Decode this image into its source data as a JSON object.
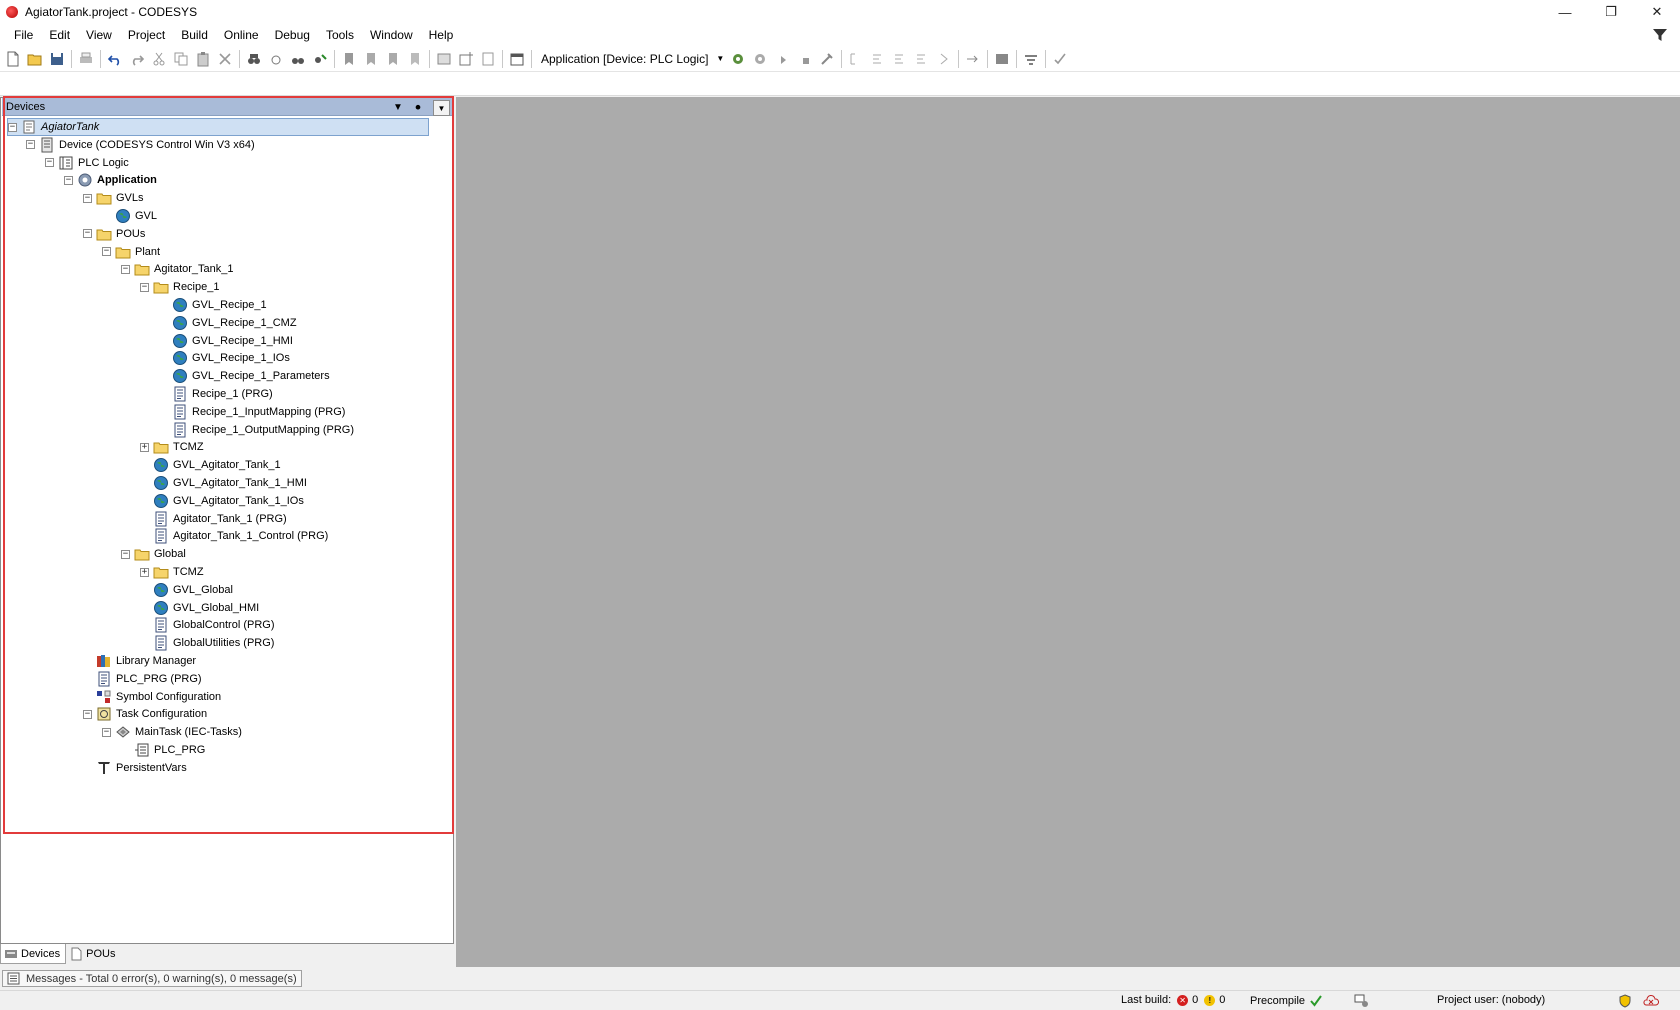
{
  "window": {
    "title": "AgiatorTank.project - CODESYS"
  },
  "menu": [
    "File",
    "Edit",
    "View",
    "Project",
    "Build",
    "Online",
    "Debug",
    "Tools",
    "Window",
    "Help"
  ],
  "toolbar": {
    "active_application": "Application [Device: PLC Logic]"
  },
  "devices_pane": {
    "title": "Devices",
    "tree": [
      {
        "label": "AgiatorTank",
        "icon": "project-icon",
        "level": 0,
        "exp": "-"
      },
      {
        "label": "Device (CODESYS Control Win V3 x64)",
        "icon": "device-icon",
        "level": 1,
        "exp": "-"
      },
      {
        "label": "PLC Logic",
        "icon": "plc-logic-icon",
        "level": 2,
        "exp": "-"
      },
      {
        "label": "Application",
        "icon": "application-gear-icon",
        "level": 3,
        "exp": "-",
        "bold": true
      },
      {
        "label": "GVLs",
        "icon": "folder-icon",
        "level": 4,
        "exp": "-"
      },
      {
        "label": "GVL",
        "icon": "gvl-globe-icon",
        "level": 5
      },
      {
        "label": "POUs",
        "icon": "folder-icon",
        "level": 4,
        "exp": "-"
      },
      {
        "label": "Plant",
        "icon": "folder-icon",
        "level": 5,
        "exp": "-"
      },
      {
        "label": "Agitator_Tank_1",
        "icon": "folder-icon",
        "level": 6,
        "exp": "-"
      },
      {
        "label": "Recipe_1",
        "icon": "folder-icon",
        "level": 7,
        "exp": "-"
      },
      {
        "label": "GVL_Recipe_1",
        "icon": "gvl-globe-icon",
        "level": 8
      },
      {
        "label": "GVL_Recipe_1_CMZ",
        "icon": "gvl-globe-icon",
        "level": 8
      },
      {
        "label": "GVL_Recipe_1_HMI",
        "icon": "gvl-globe-icon",
        "level": 8
      },
      {
        "label": "GVL_Recipe_1_IOs",
        "icon": "gvl-globe-icon",
        "level": 8
      },
      {
        "label": "GVL_Recipe_1_Parameters",
        "icon": "gvl-globe-icon",
        "level": 8
      },
      {
        "label": "Recipe_1 (PRG)",
        "icon": "prg-document-icon",
        "level": 8
      },
      {
        "label": "Recipe_1_InputMapping (PRG)",
        "icon": "prg-document-icon",
        "level": 8
      },
      {
        "label": "Recipe_1_OutputMapping (PRG)",
        "icon": "prg-document-icon",
        "level": 8
      },
      {
        "label": "TCMZ",
        "icon": "folder-icon",
        "level": 7,
        "exp": "+"
      },
      {
        "label": "GVL_Agitator_Tank_1",
        "icon": "gvl-globe-icon",
        "level": 7
      },
      {
        "label": "GVL_Agitator_Tank_1_HMI",
        "icon": "gvl-globe-icon",
        "level": 7
      },
      {
        "label": "GVL_Agitator_Tank_1_IOs",
        "icon": "gvl-globe-icon",
        "level": 7
      },
      {
        "label": "Agitator_Tank_1 (PRG)",
        "icon": "prg-document-icon",
        "level": 7
      },
      {
        "label": "Agitator_Tank_1_Control (PRG)",
        "icon": "prg-document-icon",
        "level": 7
      },
      {
        "label": "Global",
        "icon": "folder-icon",
        "level": 6,
        "exp": "-"
      },
      {
        "label": "TCMZ",
        "icon": "folder-icon",
        "level": 7,
        "exp": "+"
      },
      {
        "label": "GVL_Global",
        "icon": "gvl-globe-icon",
        "level": 7
      },
      {
        "label": "GVL_Global_HMI",
        "icon": "gvl-globe-icon",
        "level": 7
      },
      {
        "label": "GlobalControl (PRG)",
        "icon": "prg-document-icon",
        "level": 7
      },
      {
        "label": "GlobalUtilities (PRG)",
        "icon": "prg-document-icon",
        "level": 7
      },
      {
        "label": "Library Manager",
        "icon": "library-books-icon",
        "level": 4
      },
      {
        "label": "PLC_PRG (PRG)",
        "icon": "prg-document-icon",
        "level": 4
      },
      {
        "label": "Symbol Configuration",
        "icon": "symbol-config-icon",
        "level": 4
      },
      {
        "label": "Task Configuration",
        "icon": "task-config-icon",
        "level": 4,
        "exp": "-"
      },
      {
        "label": "MainTask (IEC-Tasks)",
        "icon": "task-icon",
        "level": 5,
        "exp": "-"
      },
      {
        "label": "PLC_PRG",
        "icon": "program-call-icon",
        "level": 6
      },
      {
        "label": "PersistentVars",
        "icon": "persistent-vars-icon",
        "level": 4
      }
    ]
  },
  "bottom_tabs": [
    {
      "label": "Devices",
      "active": true
    },
    {
      "label": "POUs",
      "active": false
    }
  ],
  "messages": {
    "text": "Messages - Total 0 error(s), 0 warning(s), 0 message(s)"
  },
  "status": {
    "last_build_label": "Last build:",
    "errors": "0",
    "warnings": "0",
    "precompile_label": "Precompile",
    "project_user": "Project user: (nobody)"
  }
}
